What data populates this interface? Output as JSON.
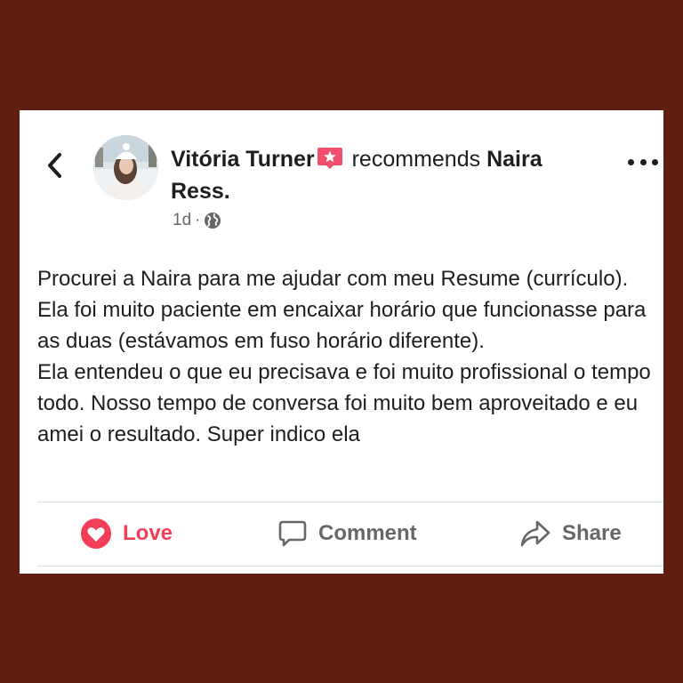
{
  "post": {
    "author_name": "Vitória Turner",
    "recommends_text": "recommends",
    "recommended_name": "Naira Ress.",
    "time": "1d",
    "separator": "·",
    "privacy_icon": "globe-icon",
    "body": "Procurei a Naira para me ajudar com meu Resume (currículo). Ela foi muito paciente em encaixar horário que funcionasse para as duas (estávamos em fuso horário diferente).\nEla entendeu o que eu precisava e foi muito profissional o tempo todo. Nosso tempo de conversa foi muito bem aproveitado e eu amei o resultado. Super indico ela"
  },
  "actions": {
    "love_label": "Love",
    "comment_label": "Comment",
    "share_label": "Share"
  },
  "colors": {
    "background": "#5e1e12",
    "love": "#f33e58",
    "badge": "#f0506e",
    "secondary_text": "#65676b"
  }
}
